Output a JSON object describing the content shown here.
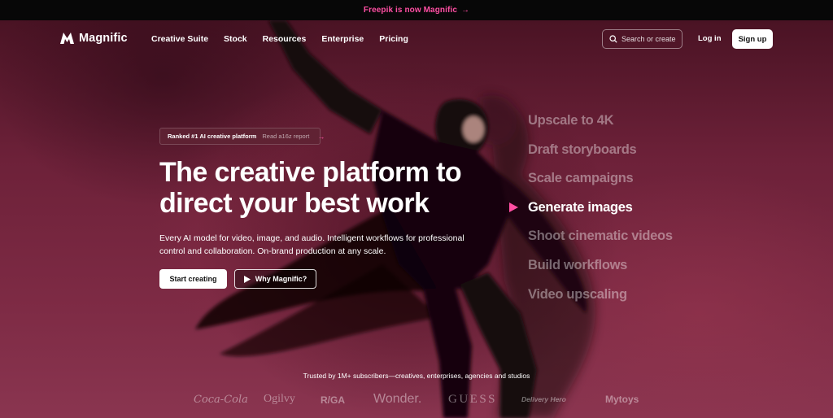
{
  "announcement": {
    "text": "Freepik is now Magnific",
    "arrow": "→"
  },
  "nav": {
    "brand": "Magnific",
    "links": [
      "Creative Suite",
      "Stock",
      "Resources",
      "Enterprise",
      "Pricing"
    ],
    "search_placeholder": "Search or create",
    "login": "Log in",
    "signup": "Sign up"
  },
  "badge": {
    "label": "Ranked #1 AI creative platform",
    "link": "Read a16z report",
    "arrow": "→"
  },
  "hero": {
    "headline_line1": "The creative platform to",
    "headline_line2": "direct your best work",
    "sub_line1": "Every AI model for video, image, and audio. Intelligent workflows for professional",
    "sub_line2": "control and collaboration. On-brand production at any scale.",
    "cta_primary": "Start creating",
    "cta_secondary": "Why Magnific?"
  },
  "usecases": {
    "items": [
      "Upscale to 4K",
      "Draft storyboards",
      "Scale campaigns",
      "Generate images",
      "Shoot cinematic videos",
      "Build workflows",
      "Video upscaling"
    ],
    "active_index": 3
  },
  "trusted": {
    "text": "Trusted by 1M+ subscribers—creatives, enterprises, agencies and studios",
    "logos": [
      "Coca-Cola",
      "Ogilvy",
      "R/GA",
      "Wonder.",
      "GUESS",
      "Delivery Hero",
      "Mytoys"
    ]
  },
  "colors": {
    "accent": "#ff4fa3",
    "background": "#6b1f36",
    "announce_bg": "#070707"
  }
}
